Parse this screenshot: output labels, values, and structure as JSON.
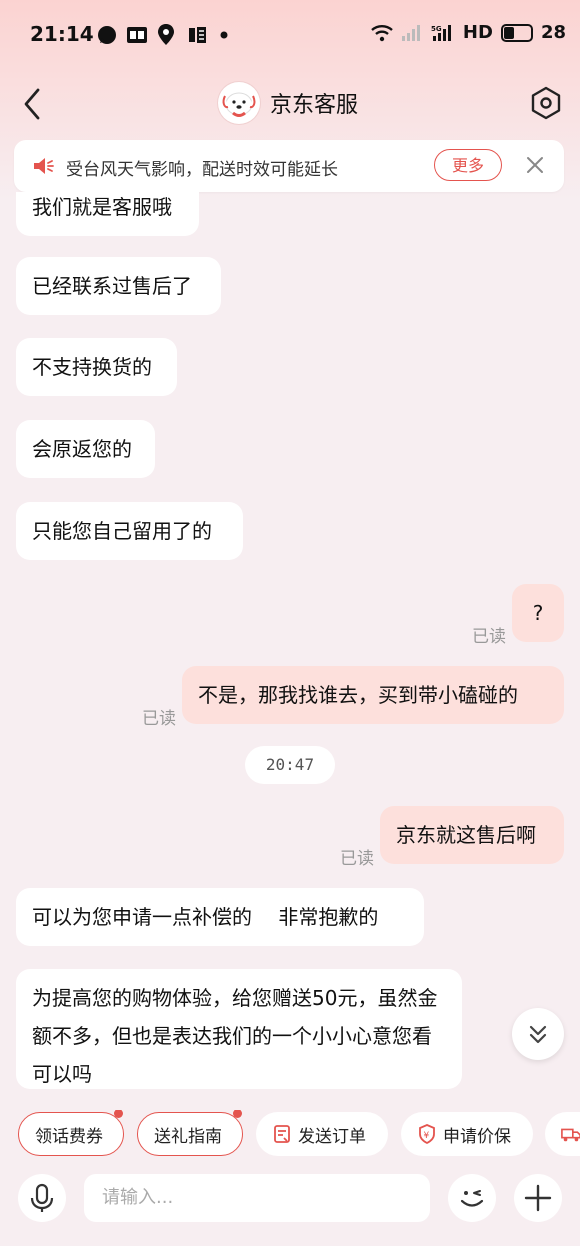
{
  "status_bar": {
    "time": "21:14",
    "network": "HD",
    "battery": "28"
  },
  "header": {
    "title": "京东客服"
  },
  "notice": {
    "text": "受台风天气影响，配送时效可能延长",
    "more_label": "更多"
  },
  "messages": [
    {
      "from": "agent",
      "text": "我们就是客服哦"
    },
    {
      "from": "agent",
      "text": "已经联系过售后了"
    },
    {
      "from": "agent",
      "text": "不支持换货的"
    },
    {
      "from": "agent",
      "text": "会原返您的"
    },
    {
      "from": "agent",
      "text": "只能您自己留用了的"
    },
    {
      "from": "user",
      "text": "?",
      "status": "已读"
    },
    {
      "from": "user",
      "text": "不是，那我找谁去，买到带小磕碰的",
      "status": "已读"
    },
    {
      "from": "system",
      "text": "20:47"
    },
    {
      "from": "user",
      "text": "京东就这售后啊",
      "status": "已读"
    },
    {
      "from": "agent",
      "text": "可以为您申请一点补偿的　 非常抱歉的"
    },
    {
      "from": "agent",
      "text": "为提高您的购物体验，给您赠送50元，虽然金额不多，但也是表达我们的一个小小心意您看可以吗"
    }
  ],
  "quick_actions": [
    {
      "label": "领话费券",
      "badge": true
    },
    {
      "label": "送礼指南",
      "badge": true
    },
    {
      "label": "发送订单",
      "icon": "order-icon"
    },
    {
      "label": "申请价保",
      "icon": "price-protect-icon"
    },
    {
      "label": "",
      "icon": "delivery-truck-icon"
    }
  ],
  "input": {
    "placeholder": "请输入..."
  },
  "colors": {
    "accent": "#e4544e",
    "user_bubble": "#fde0dc",
    "background": "#f7eef1"
  }
}
